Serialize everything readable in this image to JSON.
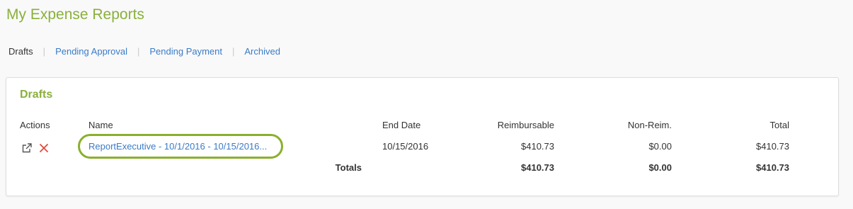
{
  "page": {
    "title": "My Expense Reports"
  },
  "tabs": [
    {
      "label": "Drafts",
      "active": true
    },
    {
      "label": "Pending Approval",
      "active": false
    },
    {
      "label": "Pending Payment",
      "active": false
    },
    {
      "label": "Archived",
      "active": false
    }
  ],
  "tab_separator": "|",
  "panel": {
    "title": "Drafts",
    "columns": {
      "actions": "Actions",
      "name": "Name",
      "end_date": "End Date",
      "reimbursable": "Reimbursable",
      "non_reim": "Non-Reim.",
      "total": "Total"
    },
    "rows": [
      {
        "name": "ReportExecutive - 10/1/2016 - 10/15/2016...",
        "end_date": "10/15/2016",
        "reimbursable": "$410.73",
        "non_reim": "$0.00",
        "total": "$410.73"
      }
    ],
    "totals": {
      "label": "Totals",
      "reimbursable": "$410.73",
      "non_reim": "$0.00",
      "total": "$410.73"
    }
  },
  "colors": {
    "brand_green": "#8ab03c",
    "link_blue": "#3a7bc8",
    "delete_red": "#e04a3a"
  },
  "icons": {
    "open": "external-link-icon",
    "delete": "delete-x-icon"
  }
}
